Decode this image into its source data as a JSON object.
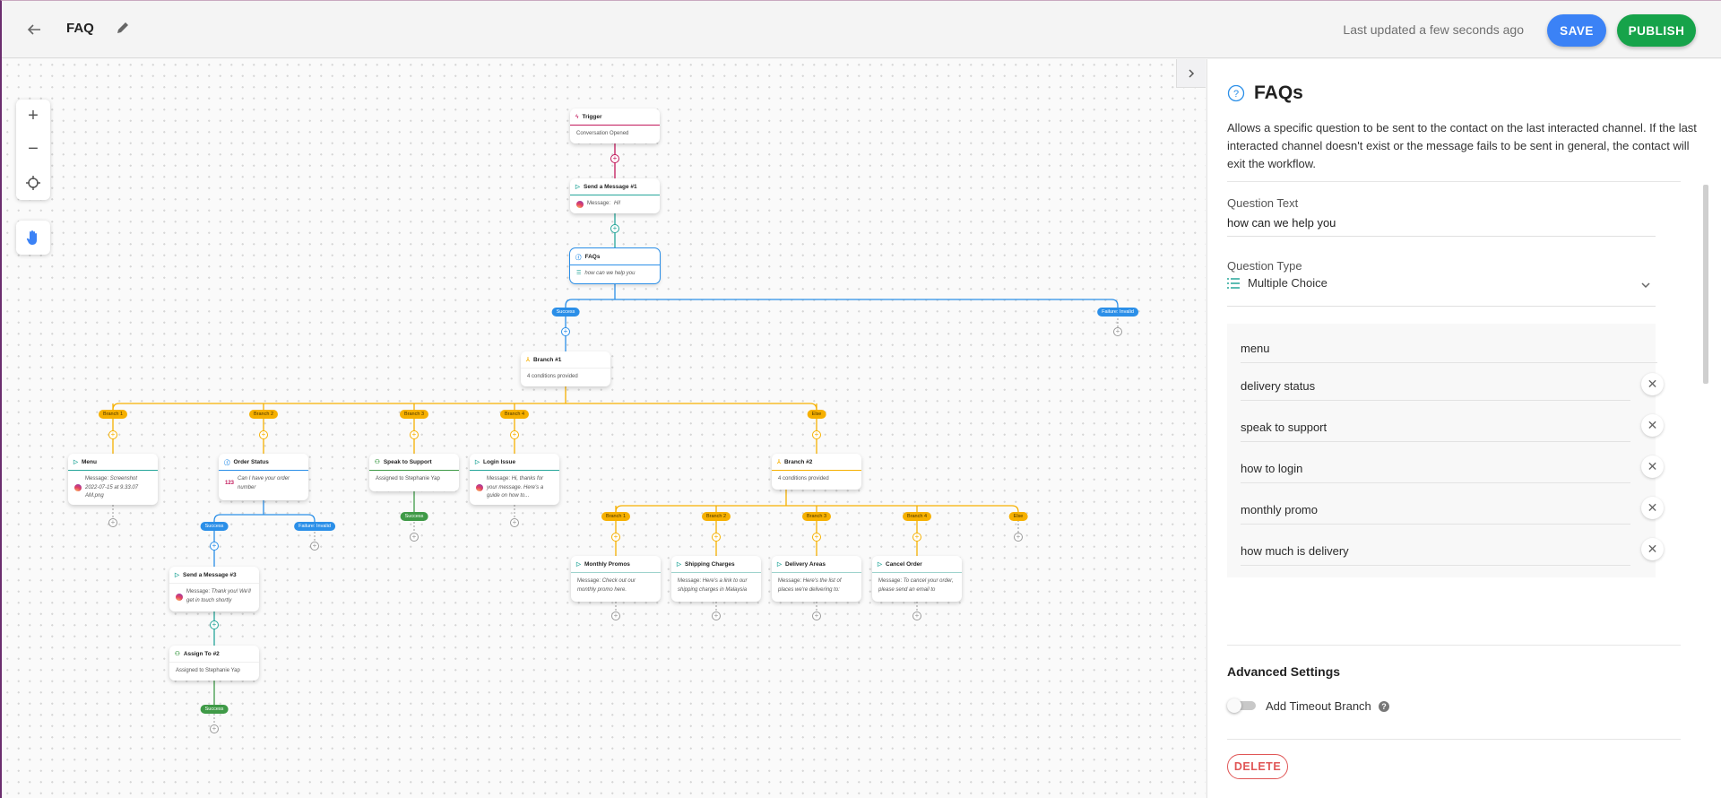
{
  "header": {
    "title": "FAQ",
    "last_updated": "Last updated a few seconds ago",
    "save_label": "SAVE",
    "publish_label": "PUBLISH"
  },
  "colors": {
    "save": "#3b82f6",
    "publish": "#16a34a",
    "delete": "#e05656",
    "trigger_edge": "#c2185b",
    "message_edge": "#26a69a",
    "faq_edge": "#2b8fe8",
    "branch_edge": "#f6b000",
    "success_green": "#3f9a47"
  },
  "canvas": {
    "zoom_in_icon": "plus-icon",
    "zoom_out_icon": "minus-icon",
    "recenter_icon": "crosshair-icon",
    "pan_icon": "hand-icon",
    "nodes": {
      "trigger": {
        "title": "Trigger",
        "body": "Conversation Opened"
      },
      "msg1": {
        "title": "Send a Message #1",
        "body_prefix": "Message:",
        "body": "Hi!"
      },
      "faqs": {
        "title": "FAQs",
        "body": "how can we help you"
      },
      "branch1": {
        "title": "Branch #1",
        "body": "4 conditions provided"
      },
      "menu": {
        "title": "Menu",
        "body_prefix": "Message:",
        "body": "Screenshot 2022-07-15 at 9.33.07 AM.png"
      },
      "order_status": {
        "title": "Order Status",
        "body": "Can I have your order number"
      },
      "speak_support": {
        "title": "Speak to Support",
        "body": "Assigned to Stephanie Yap"
      },
      "login_issue": {
        "title": "Login Issue",
        "body_prefix": "Message:",
        "body": "Hi, thanks for your message. Here's a guide on how to..."
      },
      "branch2": {
        "title": "Branch #2",
        "body": "4 conditions provided"
      },
      "msg3": {
        "title": "Send a Message #3",
        "body_prefix": "Message:",
        "body": "Thank you! We'll get in touch shortly"
      },
      "assign2": {
        "title": "Assign To #2",
        "body": "Assigned to Stephanie Yap"
      },
      "monthly_promos": {
        "title": "Monthly Promos",
        "body_prefix": "Message:",
        "body": "Check out our monthly promo here."
      },
      "shipping": {
        "title": "Shipping Charges",
        "body_prefix": "Message:",
        "body": "Here's a link to our shipping charges in Malaysia"
      },
      "delivery_areas": {
        "title": "Delivery Areas",
        "body_prefix": "Message:",
        "body": "Here's the list of places we're delivering to:"
      },
      "cancel_order": {
        "title": "Cancel Order",
        "body_prefix": "Message:",
        "body": "To cancel your order, please send an email to"
      }
    },
    "labels": {
      "success": "Success",
      "failure_invalid": "Failure: Invalid",
      "branch_1": "Branch 1",
      "branch_2": "Branch 2",
      "branch_3": "Branch 3",
      "branch_4": "Branch 4",
      "else": "Else",
      "order_number_badge": "123"
    }
  },
  "panel": {
    "title": "FAQs",
    "description": "Allows a specific question to be sent to the contact on the last interacted channel. If the last interacted channel doesn't exist or the message fails to be sent in general, the contact will exit the workflow.",
    "question_text_label": "Question Text",
    "question_text_value": "how can we help you",
    "question_type_label": "Question Type",
    "question_type_value": "Multiple Choice",
    "choices": [
      "menu",
      "delivery status",
      "speak to support",
      "how to login",
      "monthly promo",
      "how much is delivery"
    ],
    "advanced_settings_label": "Advanced Settings",
    "timeout_label": "Add Timeout Branch",
    "timeout_enabled": false,
    "delete_label": "DELETE"
  }
}
